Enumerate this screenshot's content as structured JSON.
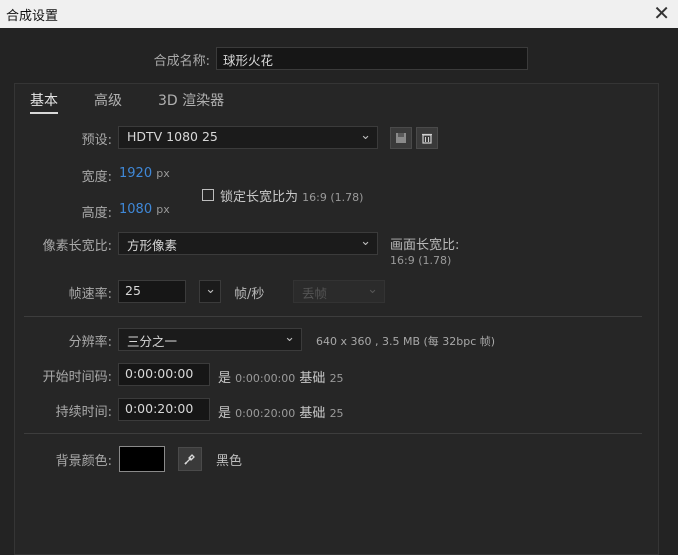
{
  "window": {
    "title": "合成设置",
    "close_glyph": "✕"
  },
  "comp_name": {
    "label": "合成名称:",
    "value": "球形火花"
  },
  "tabs": [
    {
      "label": "基本",
      "active": true
    },
    {
      "label": "高级",
      "active": false
    },
    {
      "label": "3D 渲染器",
      "active": false
    }
  ],
  "preset": {
    "label": "预设:",
    "value": "HDTV 1080 25",
    "save_icon": "save-preset-icon",
    "delete_icon": "trash-icon"
  },
  "width": {
    "label": "宽度:",
    "value": "1920",
    "unit": "px"
  },
  "height": {
    "label": "高度:",
    "value": "1080",
    "unit": "px"
  },
  "lock_aspect": {
    "label": "锁定长宽比为",
    "ratio": "16:9 (1.78)",
    "checked": false
  },
  "pixel_aspect": {
    "label": "像素长宽比:",
    "value": "方形像素"
  },
  "frame_aspect": {
    "label": "画面长宽比:",
    "value": "16:9 (1.78)"
  },
  "frame_rate": {
    "label": "帧速率:",
    "value": "25",
    "unit": "帧/秒",
    "drop_frame": "丢帧"
  },
  "resolution": {
    "label": "分辨率:",
    "value": "三分之一",
    "info": "640 x 360 , 3.5 MB (每 32bpc 帧)"
  },
  "start_timecode": {
    "label": "开始时间码:",
    "value": "0:00:00:00",
    "is_label": "是",
    "is_value": "0:00:00:00",
    "base_label": "基础",
    "base_value": "25"
  },
  "duration": {
    "label": "持续时间:",
    "value": "0:00:20:00",
    "is_label": "是",
    "is_value": "0:00:20:00",
    "base_label": "基础",
    "base_value": "25"
  },
  "background": {
    "label": "背景颜色:",
    "color_name": "黑色",
    "swatch": "#000000",
    "eyedropper_icon": "eyedropper-icon"
  }
}
